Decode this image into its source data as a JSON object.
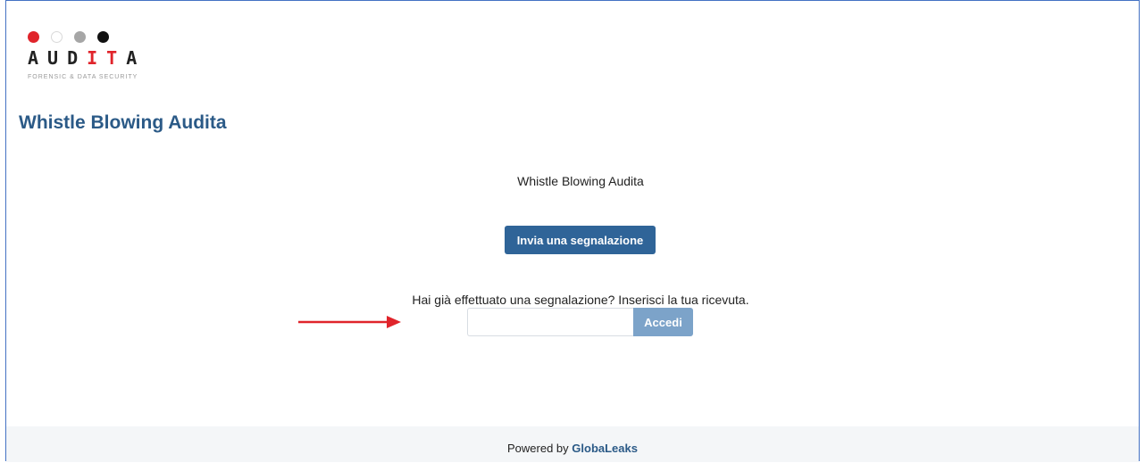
{
  "logo": {
    "dot_colors": [
      "#e0242b",
      "#ffffff",
      "#a6a6a6",
      "#111111"
    ],
    "word_before": "AUD",
    "word_accent": "IT",
    "word_after": "A",
    "tagline": "FORENSIC & DATA SECURITY"
  },
  "header": {
    "title": "Whistle Blowing Audita"
  },
  "main": {
    "subtitle": "Whistle Blowing Audita",
    "submit_button_label": "Invia una segnalazione",
    "receipt_prompt": "Hai già effettuato una segnalazione? Inserisci la tua ricevuta.",
    "receipt_input_value": "",
    "login_button_label": "Accedi"
  },
  "annotation": {
    "arrow_color": "#e0242b",
    "arrow_icon": "right-arrow-icon"
  },
  "footer": {
    "powered_by": "Powered by",
    "brand": "GlobaLeaks"
  },
  "colors": {
    "brand_blue": "#2f6498",
    "title_blue": "#2b5a87",
    "accent_red": "#e0242b"
  }
}
